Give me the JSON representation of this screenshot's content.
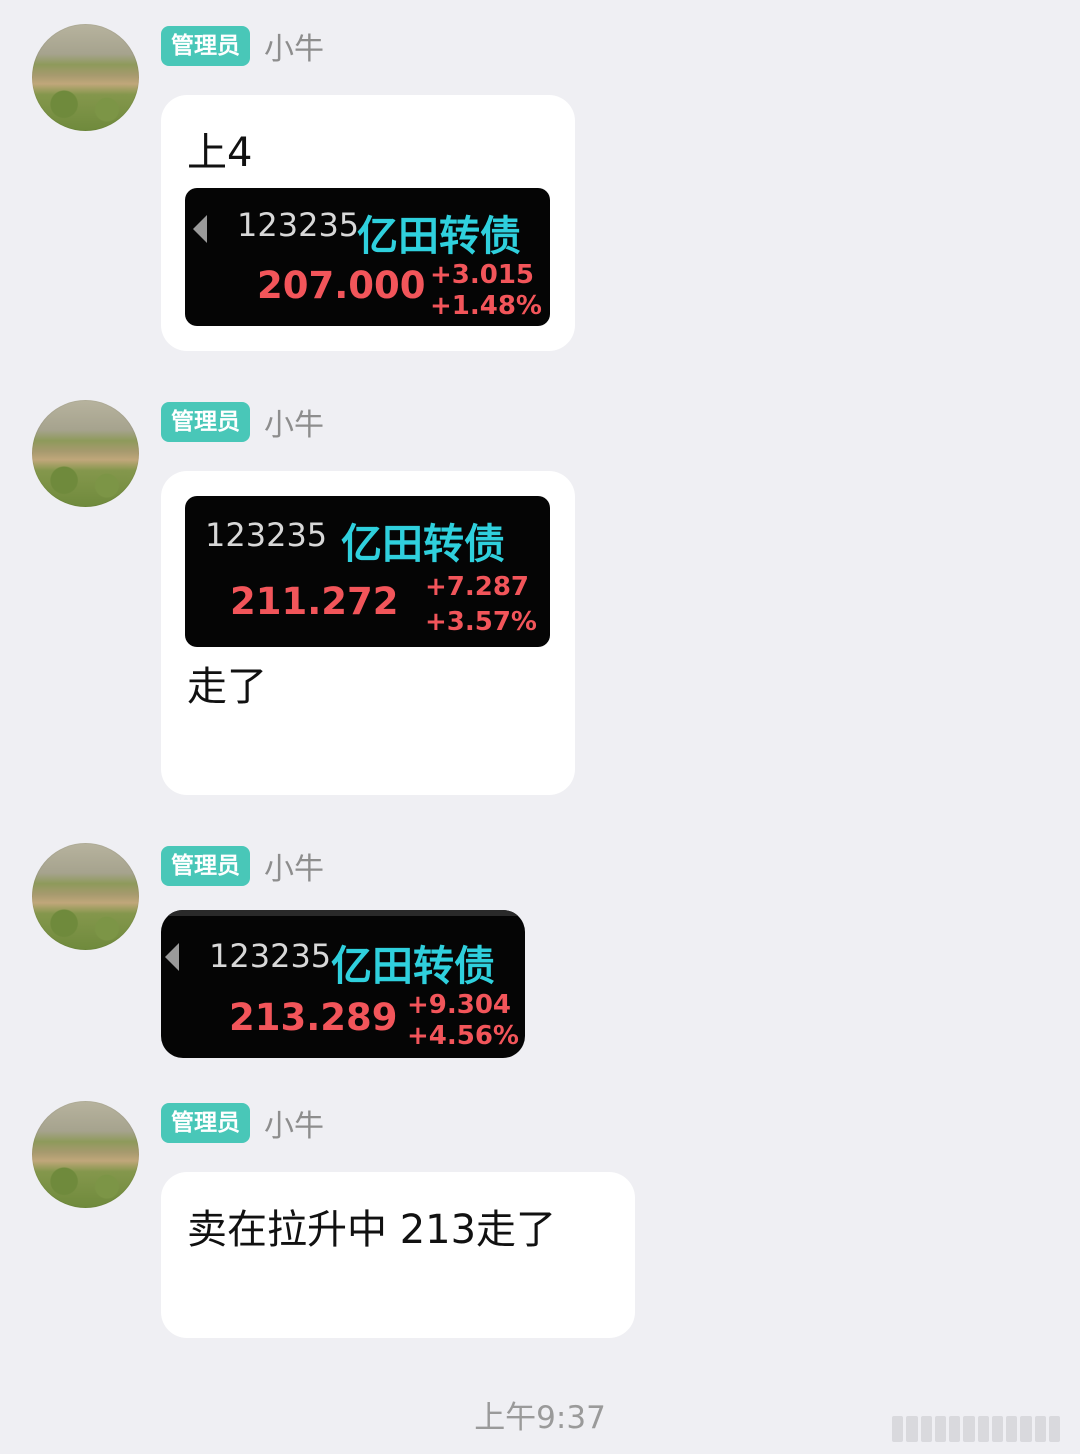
{
  "messages": [
    {
      "role_badge": "管理员",
      "sender": "小牛",
      "text_before": "上4",
      "quote": {
        "code": "123235",
        "name": "亿田转债",
        "price": "207.000",
        "change": "+3.015",
        "change_pct": "+1.48%"
      }
    },
    {
      "role_badge": "管理员",
      "sender": "小牛",
      "quote": {
        "code": "123235",
        "name": "亿田转债",
        "price": "211.272",
        "change": "+7.287",
        "change_pct": "+3.57%"
      },
      "text_after": "走了"
    },
    {
      "role_badge": "管理员",
      "sender": "小牛",
      "quote": {
        "code": "123235",
        "name": "亿田转债",
        "price": "213.289",
        "change": "+9.304",
        "change_pct": "+4.56%"
      }
    },
    {
      "role_badge": "管理员",
      "sender": "小牛",
      "text": "卖在拉升中 213走了"
    }
  ],
  "timestamp": "上午9:37",
  "colors": {
    "badge": "#49c7b8",
    "quote_name": "#2fd0dd",
    "quote_price": "#f2555a",
    "background": "#efeff3"
  }
}
